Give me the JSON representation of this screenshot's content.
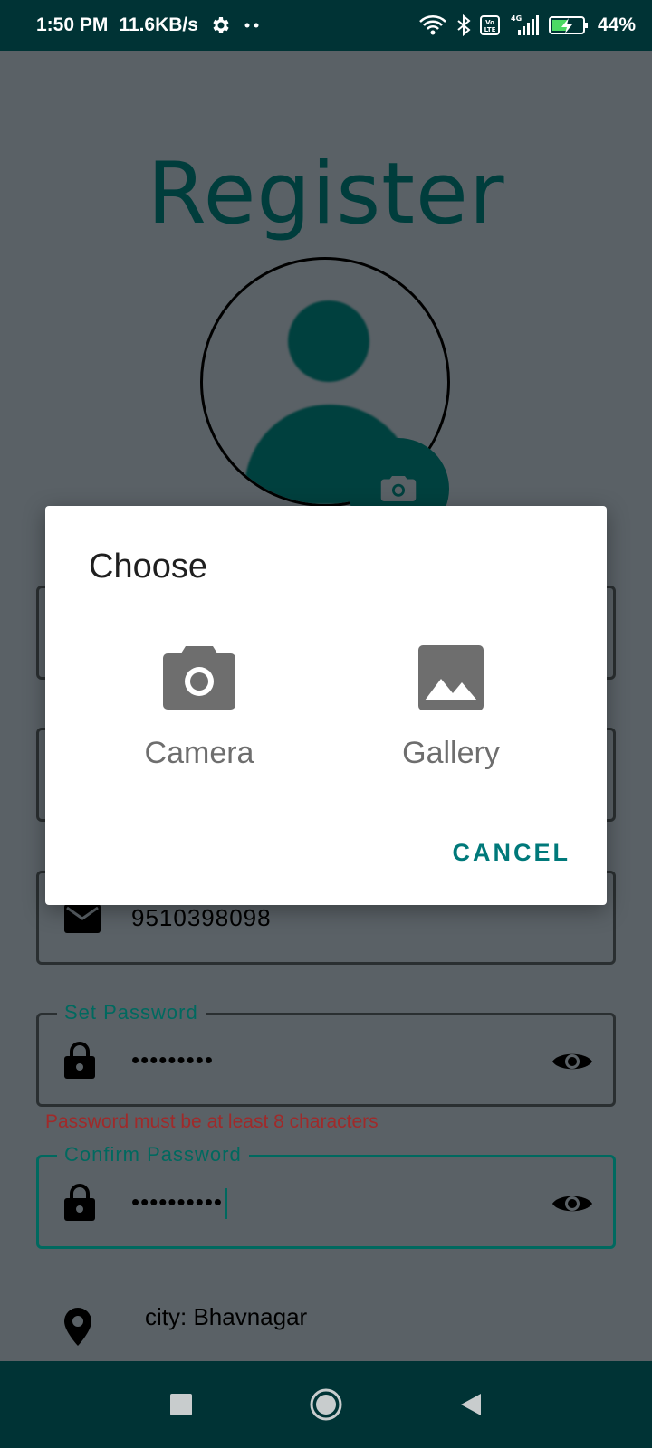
{
  "status_bar": {
    "time": "1:50 PM",
    "speed": "11.6KB/s",
    "battery": "44%",
    "network": "4G",
    "volte": "Vo LTE",
    "icons": [
      "settings-icon",
      "dots-icon",
      "wifi-icon",
      "bluetooth-icon",
      "volte-icon",
      "signal-icon",
      "battery-icon"
    ]
  },
  "screen": {
    "title": "Register",
    "fields": {
      "phone_value": "9510398098",
      "set_password_label": "Set Password",
      "set_password_value": "•••••••••",
      "set_password_error": "Password must be at least 8 characters",
      "confirm_password_label": "Confirm Password",
      "confirm_password_value": "••••••••••"
    },
    "city_label": "city: Bhavnagar"
  },
  "dialog": {
    "title": "Choose",
    "options": [
      {
        "label": "Camera",
        "icon": "camera-icon"
      },
      {
        "label": "Gallery",
        "icon": "gallery-icon"
      }
    ],
    "cancel_label": "CANCEL"
  },
  "colors": {
    "status_bar": "#003335",
    "accent": "#00797a",
    "title": "#003d3c",
    "scrim_bg": "#5a6166",
    "error": "#a02a2a"
  },
  "nav": [
    "recents-button",
    "home-button",
    "back-button"
  ]
}
